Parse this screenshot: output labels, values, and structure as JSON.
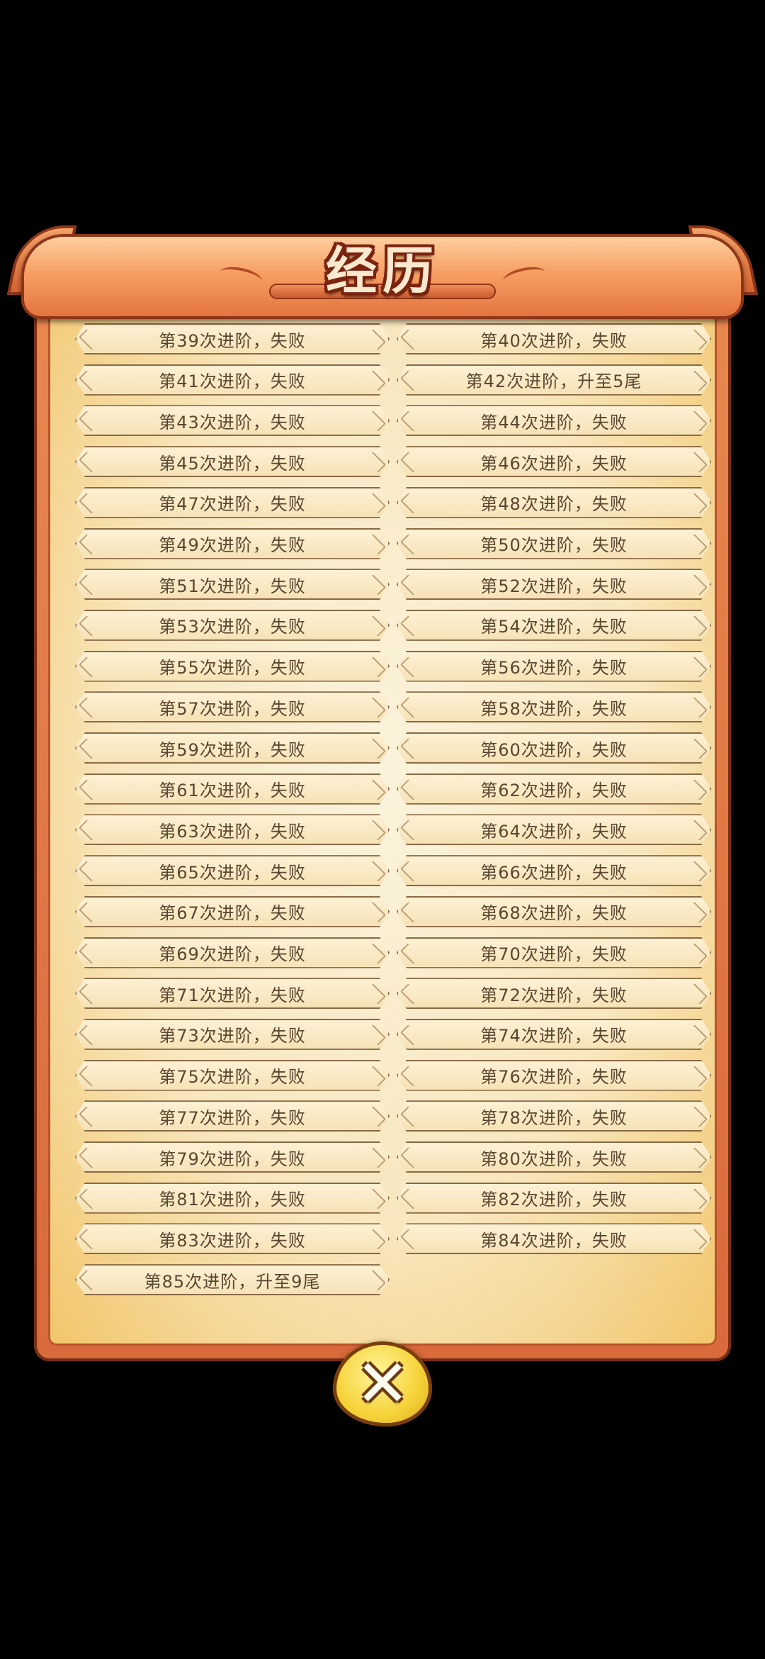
{
  "dialog": {
    "title": "经历",
    "close_icon": "close-icon"
  },
  "records": [
    "第39次进阶，失败",
    "第40次进阶，失败",
    "第41次进阶，失败",
    "第42次进阶，升至5尾",
    "第43次进阶，失败",
    "第44次进阶，失败",
    "第45次进阶，失败",
    "第46次进阶，失败",
    "第47次进阶，失败",
    "第48次进阶，失败",
    "第49次进阶，失败",
    "第50次进阶，失败",
    "第51次进阶，失败",
    "第52次进阶，失败",
    "第53次进阶，失败",
    "第54次进阶，失败",
    "第55次进阶，失败",
    "第56次进阶，失败",
    "第57次进阶，失败",
    "第58次进阶，失败",
    "第59次进阶，失败",
    "第60次进阶，失败",
    "第61次进阶，失败",
    "第62次进阶，失败",
    "第63次进阶，失败",
    "第64次进阶，失败",
    "第65次进阶，失败",
    "第66次进阶，失败",
    "第67次进阶，失败",
    "第68次进阶，失败",
    "第69次进阶，失败",
    "第70次进阶，失败",
    "第71次进阶，失败",
    "第72次进阶，失败",
    "第73次进阶，失败",
    "第74次进阶，失败",
    "第75次进阶，失败",
    "第76次进阶，失败",
    "第77次进阶，失败",
    "第78次进阶，失败",
    "第79次进阶，失败",
    "第80次进阶，失败",
    "第81次进阶，失败",
    "第82次进阶，失败",
    "第83次进阶，失败",
    "第84次进阶，失败",
    "第85次进阶，升至9尾"
  ],
  "colors": {
    "panel_border": "#d96a3b",
    "parchment": "#f8e7bf",
    "record_text": "#5a4630",
    "close_button": "#f6d33a"
  }
}
